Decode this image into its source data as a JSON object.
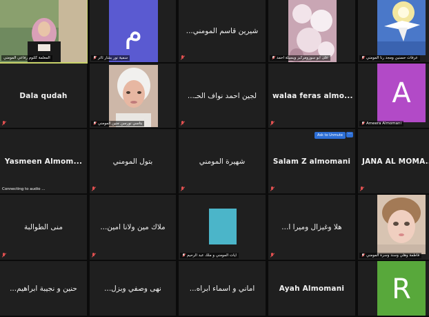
{
  "meeting": {
    "tiles": [
      {
        "id": "r1c1",
        "name": "المعلمة كلثوم رفاعي المومني",
        "type": "video"
      },
      {
        "id": "r1c2",
        "name": "سمية نور بشار ثائر",
        "type": "avatar",
        "letter": "م",
        "avatar_color": "#5a5ad1"
      },
      {
        "id": "r1c3",
        "name": "...شيرين قاسم المومني",
        "type": "name"
      },
      {
        "id": "r1c4",
        "name": "على ابو سوزومركيز ويسيلة احمد",
        "type": "image"
      },
      {
        "id": "r1c5",
        "name": "عرفات حسنين ومجد رنا المومني",
        "type": "image"
      },
      {
        "id": "r2c1",
        "name": "Dala qudah",
        "type": "name"
      },
      {
        "id": "r2c2",
        "name": "بتاسي نورسن جنين المومني",
        "type": "image"
      },
      {
        "id": "r2c3",
        "name": "...لجين احمد نواف الحـ",
        "type": "name"
      },
      {
        "id": "r2c4",
        "name": "walaa feras almo...",
        "type": "name"
      },
      {
        "id": "r2c5",
        "name": "Ameera Almomani",
        "type": "avatar",
        "letter": "A",
        "avatar_color": "#b24ac7"
      },
      {
        "id": "r3c1",
        "name": "Yasmeen  Almom...",
        "type": "name",
        "status": "Connecting to audio ..."
      },
      {
        "id": "r3c2",
        "name": "بتول المومني",
        "type": "name"
      },
      {
        "id": "r3c3",
        "name": "شهيرة المومني",
        "type": "name"
      },
      {
        "id": "r3c4",
        "name": "Salam Z almomani",
        "type": "name",
        "ask_label": "Ask to Unmute",
        "more_label": "···"
      },
      {
        "id": "r3c5",
        "name": "JANA AL MOMA...",
        "type": "name"
      },
      {
        "id": "r4c1",
        "name": "منى الطوالبة",
        "type": "name"
      },
      {
        "id": "r4c2",
        "name": "...ملاك مين ولانا امين",
        "type": "name"
      },
      {
        "id": "r4c3",
        "name": "ايات المومني و ملك عبد الرحيم",
        "type": "square",
        "square_color": "#4bb5c9"
      },
      {
        "id": "r4c4",
        "name": "...هلا وغيزال وميرا ا",
        "type": "name"
      },
      {
        "id": "r4c5",
        "name": "فاطمة وهلي وسند وسرة المومني",
        "type": "image"
      },
      {
        "id": "r5c1",
        "name": "...حنين و نجيبة ابراهيم",
        "type": "name"
      },
      {
        "id": "r5c2",
        "name": "...نهى وصفي وبزل",
        "type": "name"
      },
      {
        "id": "r5c3",
        "name": "...اماني و اسماء ابراه",
        "type": "name"
      },
      {
        "id": "r5c4",
        "name": "Ayah Almomani",
        "type": "name"
      },
      {
        "id": "r5c5",
        "name": "",
        "type": "avatar",
        "letter": "R",
        "avatar_color": "#58a83b"
      }
    ]
  }
}
